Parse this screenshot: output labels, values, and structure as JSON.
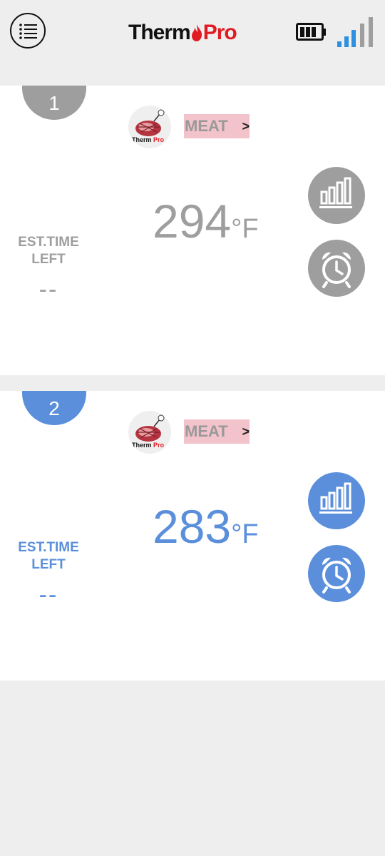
{
  "header": {
    "logo_part1": "Therm",
    "logo_part2": "Pro",
    "menu_icon": "menu-list-icon",
    "battery_icon": "battery-icon",
    "signal_icon": "signal-bars-icon"
  },
  "colors": {
    "probe1_accent": "#9e9e9e",
    "probe2_accent": "#5b8fdb",
    "meat_button_bg": "#f2c3cb",
    "brand_red": "#e11b22"
  },
  "probes": [
    {
      "number": "1",
      "food_label": "MEAT",
      "food_chevron": ">",
      "temperature": "294",
      "unit": "°F",
      "est_label": "EST.TIME LEFT",
      "est_value": "--"
    },
    {
      "number": "2",
      "food_label": "MEAT",
      "food_chevron": ">",
      "temperature": "283",
      "unit": "°F",
      "est_label": "EST.TIME LEFT",
      "est_value": "--"
    }
  ]
}
